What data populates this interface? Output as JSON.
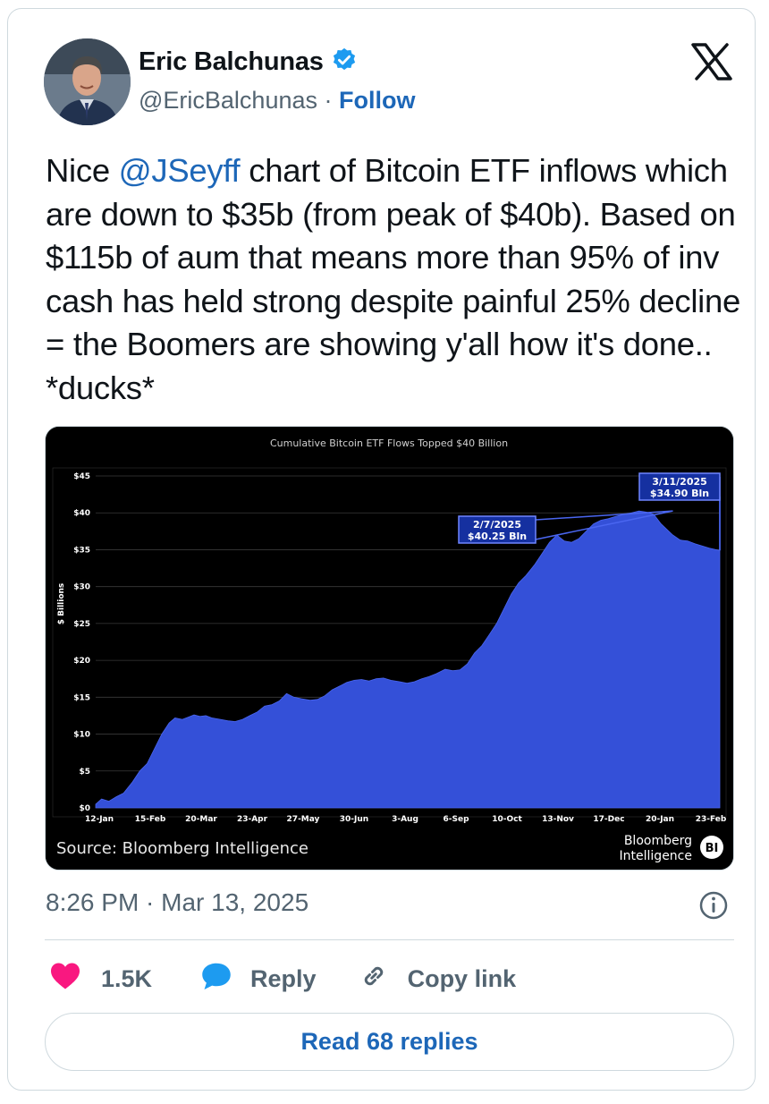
{
  "author": {
    "name": "Eric Balchunas",
    "handle": "@EricBalchunas",
    "separator": "·",
    "follow_label": "Follow"
  },
  "tweet": {
    "text_before": "Nice ",
    "mention": "@JSeyff",
    "text_after": " chart of Bitcoin ETF inflows which are down to $35b (from peak of $40b). Based on $115b of aum that means more than 95% of inv cash has held strong despite painful 25% decline = the Boomers are showing y'all how it's done.. *ducks*"
  },
  "timestamp": "8:26 PM · Mar 13, 2025",
  "actions": {
    "likes": "1.5K",
    "reply_label": "Reply",
    "copy_link_label": "Copy link"
  },
  "read_replies_label": "Read 68 replies",
  "colors": {
    "link_blue": "#1d67b8",
    "heart_red": "#f91880",
    "reply_blue": "#1d9bf0",
    "chart_fill": "#3450d8",
    "verified_blue": "#1d9bf0"
  },
  "icons": {
    "verified": "verified-badge-icon",
    "brand": "x-logo-icon",
    "info": "info-icon",
    "like": "heart-icon",
    "reply": "speech-bubble-icon",
    "link": "link-icon"
  },
  "chart_data": {
    "type": "area",
    "title": "Cumulative Bitcoin ETF Flows Topped $40 Billion",
    "ylabel": "$ Billions",
    "ylim": [
      0,
      45
    ],
    "yticks": [
      "$0",
      "$5",
      "$10",
      "$15",
      "$20",
      "$25",
      "$30",
      "$35",
      "$40",
      "$45"
    ],
    "xticks": [
      "12-Jan",
      "15-Feb",
      "20-Mar",
      "23-Apr",
      "27-May",
      "30-Jun",
      "3-Aug",
      "6-Sep",
      "10-Oct",
      "13-Nov",
      "17-Dec",
      "20-Jan",
      "23-Feb"
    ],
    "grid": true,
    "source": "Source: Bloomberg Intelligence",
    "brand_line1": "Bloomberg",
    "brand_line2": "Intelligence",
    "brand_badge": "BI",
    "annotations": [
      {
        "date_label": "2/7/2025",
        "value_label": "$40.25 Bln"
      },
      {
        "date_label": "3/11/2025",
        "value_label": "$34.90 Bln"
      }
    ],
    "series": [
      {
        "x": [
          "2024-01-11",
          "2024-01-15",
          "2024-01-20",
          "2024-01-25",
          "2024-01-30",
          "2024-02-05",
          "2024-02-10",
          "2024-02-15",
          "2024-02-20",
          "2024-02-25",
          "2024-03-01",
          "2024-03-05",
          "2024-03-10",
          "2024-03-14",
          "2024-03-18",
          "2024-03-22",
          "2024-03-26",
          "2024-03-30",
          "2024-04-05",
          "2024-04-10",
          "2024-04-15",
          "2024-04-20",
          "2024-04-25",
          "2024-04-30",
          "2024-05-05",
          "2024-05-10",
          "2024-05-15",
          "2024-05-20",
          "2024-05-25",
          "2024-05-30",
          "2024-06-05",
          "2024-06-10",
          "2024-06-15",
          "2024-06-20",
          "2024-06-25",
          "2024-06-30",
          "2024-07-05",
          "2024-07-10",
          "2024-07-15",
          "2024-07-20",
          "2024-07-25",
          "2024-07-30",
          "2024-08-05",
          "2024-08-10",
          "2024-08-15",
          "2024-08-20",
          "2024-08-25",
          "2024-08-30",
          "2024-09-05",
          "2024-09-10",
          "2024-09-15",
          "2024-09-20",
          "2024-09-25",
          "2024-09-30",
          "2024-10-05",
          "2024-10-10",
          "2024-10-15",
          "2024-10-20",
          "2024-10-25",
          "2024-10-30",
          "2024-11-05",
          "2024-11-10",
          "2024-11-15",
          "2024-11-20",
          "2024-11-25",
          "2024-11-30",
          "2024-12-05",
          "2024-12-10",
          "2024-12-15",
          "2024-12-20",
          "2024-12-25",
          "2024-12-30",
          "2025-01-05",
          "2025-01-10",
          "2025-01-15",
          "2025-01-20",
          "2025-01-25",
          "2025-01-30",
          "2025-02-07",
          "2025-02-12",
          "2025-02-17",
          "2025-02-22",
          "2025-02-27",
          "2025-03-04",
          "2025-03-11"
        ],
        "y": [
          0.5,
          1.2,
          0.9,
          1.5,
          2.0,
          3.5,
          5.0,
          6.0,
          8.0,
          10.0,
          11.5,
          12.2,
          12.0,
          12.3,
          12.6,
          12.4,
          12.5,
          12.2,
          12.0,
          11.8,
          11.7,
          12.0,
          12.5,
          13.0,
          13.8,
          14.0,
          14.5,
          15.5,
          15.0,
          14.8,
          14.6,
          14.7,
          15.2,
          16.0,
          16.5,
          17.0,
          17.3,
          17.4,
          17.2,
          17.5,
          17.6,
          17.3,
          17.1,
          16.9,
          17.1,
          17.5,
          17.8,
          18.2,
          18.8,
          18.6,
          18.7,
          19.5,
          21.0,
          22.0,
          23.5,
          25.0,
          27.0,
          29.0,
          30.5,
          31.5,
          33.0,
          34.5,
          36.0,
          37.0,
          36.2,
          36.0,
          36.5,
          37.5,
          38.5,
          39.0,
          39.2,
          39.5,
          39.8,
          40.0,
          40.25,
          40.1,
          39.8,
          38.5,
          37.0,
          36.3,
          36.2,
          35.8,
          35.5,
          35.2,
          34.9
        ]
      }
    ]
  }
}
